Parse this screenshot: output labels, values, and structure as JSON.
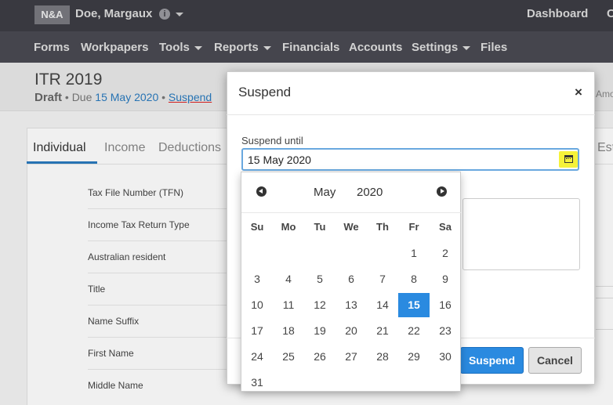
{
  "topbar": {
    "logo": "N&A",
    "client_name": "Doe, Margaux",
    "dashboard": "Dashboard",
    "cut_right": "C"
  },
  "nav": {
    "items": [
      "Forms",
      "Workpapers",
      "Tools",
      "Reports",
      "Financials",
      "Accounts",
      "Settings",
      "Files"
    ]
  },
  "page": {
    "title": "ITR 2019",
    "status": "Draft",
    "due_prefix": "• Due",
    "due_date": "15 May 2020",
    "sep": "•",
    "suspend_link": "Suspend",
    "right_cut": "Amo"
  },
  "tabs": [
    "Individual",
    "Income",
    "Deductions"
  ],
  "tab_cut": "Esti",
  "fields": [
    "Tax File Number (TFN)",
    "Income Tax Return Type",
    "Australian resident",
    "Title",
    "Name Suffix",
    "First Name",
    "Middle Name"
  ],
  "modal": {
    "title": "Suspend",
    "close": "×",
    "suspend_until_label": "Suspend until",
    "date_value": "15 May 2020",
    "suspend_button": "Suspend",
    "cancel_button": "Cancel"
  },
  "datepicker": {
    "month": "May",
    "year": "2020",
    "weekdays": [
      "Su",
      "Mo",
      "Tu",
      "We",
      "Th",
      "Fr",
      "Sa"
    ],
    "selected_day": 15,
    "weeks": [
      [
        "",
        "",
        "",
        "",
        "",
        "1",
        "2"
      ],
      [
        "3",
        "4",
        "5",
        "6",
        "7",
        "8",
        "9"
      ],
      [
        "10",
        "11",
        "12",
        "13",
        "14",
        "15",
        "16"
      ],
      [
        "17",
        "18",
        "19",
        "20",
        "21",
        "22",
        "23"
      ],
      [
        "24",
        "25",
        "26",
        "27",
        "28",
        "29",
        "30"
      ],
      [
        "31",
        "",
        "",
        "",
        "",
        "",
        ""
      ]
    ]
  },
  "colors": {
    "topbar": "#3d3d44",
    "navbar": "#4a4a52",
    "accent": "#2a8ae0",
    "highlight": "#f5f23a"
  }
}
